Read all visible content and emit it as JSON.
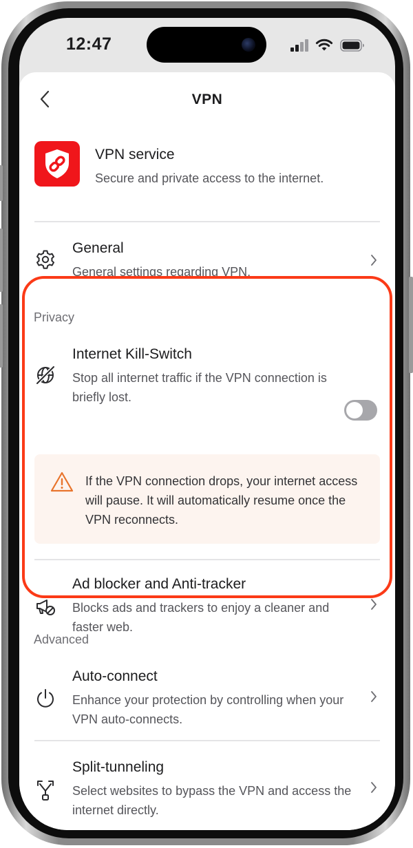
{
  "status_bar": {
    "time": "12:47"
  },
  "nav": {
    "title": "VPN"
  },
  "service": {
    "title": "VPN service",
    "subtitle": "Secure and private access to the internet."
  },
  "general": {
    "title": "General",
    "subtitle": "General settings regarding VPN."
  },
  "privacy": {
    "label": "Privacy",
    "kill_switch": {
      "title": "Internet Kill-Switch",
      "subtitle": "Stop all internet traffic if the VPN connection is briefly lost.",
      "enabled": false
    },
    "warning": "If the VPN connection drops, your internet access will pause. It will automatically resume once the VPN reconnects.",
    "ad_blocker": {
      "title": "Ad blocker and Anti-tracker",
      "subtitle": "Blocks ads and trackers to enjoy a cleaner and faster web."
    }
  },
  "advanced": {
    "label": "Advanced",
    "auto_connect": {
      "title": "Auto-connect",
      "subtitle": "Enhance your protection by controlling when your VPN auto-connects."
    },
    "split_tunneling": {
      "title": "Split-tunneling",
      "subtitle": "Select websites to bypass the VPN and access the internet directly."
    }
  },
  "colors": {
    "brand_red": "#f0161b",
    "highlight": "#fb3a17",
    "warning_bg": "#fdf4ef",
    "warning_icon": "#e8742c",
    "toggle_off": "#a7a7ab"
  },
  "icons": {
    "back": "chevron-left-icon",
    "logo": "shield-link-icon",
    "general": "gear-icon",
    "kill_switch": "globe-off-icon",
    "warning": "warning-triangle-icon",
    "ad_blocker": "megaphone-block-icon",
    "auto_connect": "power-icon",
    "split_tunneling": "split-arrows-icon",
    "chevron": "chevron-right-icon"
  }
}
